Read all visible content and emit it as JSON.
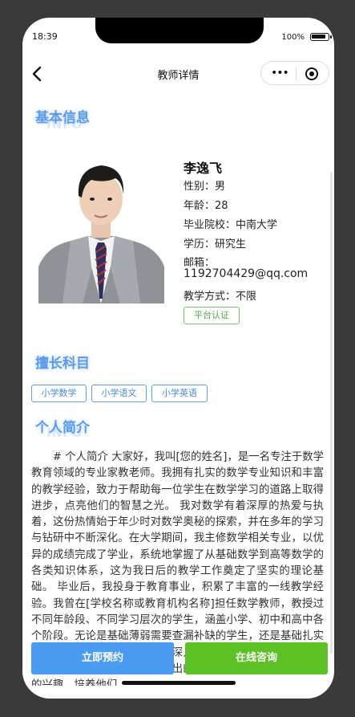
{
  "status": {
    "time": "18:39",
    "battery": "100%"
  },
  "nav": {
    "title": "教师详情",
    "more_icon": "•••"
  },
  "sections": {
    "basic": {
      "title": "基本信息",
      "shadow": "INFO"
    },
    "subjects": {
      "title": "擅长科目"
    },
    "intro": {
      "title": "个人简介",
      "shadow": "INFO"
    }
  },
  "teacher": {
    "name": "李逸飞",
    "gender": "性别：男",
    "age": "年龄：28",
    "school": "毕业院校：中南大学",
    "degree": "学历：研究生",
    "email_label": "邮箱：",
    "email": "1192704429@qq.com",
    "teaching_mode": "教学方式：不限",
    "cert_label": "平台认证"
  },
  "subjects": [
    "小学数学",
    "小学语文",
    "小学英语"
  ],
  "bio": "# 个人简介 大家好，我叫[您的姓名]，是一名专注于数学教育领域的专业家教老师。我拥有扎实的数学专业知识和丰富的教学经验，致力于帮助每一位学生在数学学习的道路上取得进步，点亮他们的智慧之光。 我对数学有着深厚的热爱与执着，这份热情始于年少时对数学奥秘的探索，并在多年的学习与钻研中不断深化。在大学期间，我主修数学相关专业，以优异的成绩完成了学业，系统地掌握了从基础数学到高等数学的各类知识体系，这为我日后的教学工作奠定了坚实的理论基础。 毕业后，我投身于教育事业，积累了丰富的一线教学经验。我曾在[学校名称或教育机构名称]担任数学教师，教授过不同年龄段、不同学习层次的学生，涵盖小学、初中和高中各个阶段。无论是基础薄弱需要查漏补缺的学生，还是基础扎实需要拓展提高的学生，我都能深入分析学生的学习特点和问题所在，运用生动有趣、深入浅出的教学方法，激发他们对数学的兴趣，培养他们",
  "actions": {
    "book": "立即预约",
    "consult": "在线咨询"
  }
}
